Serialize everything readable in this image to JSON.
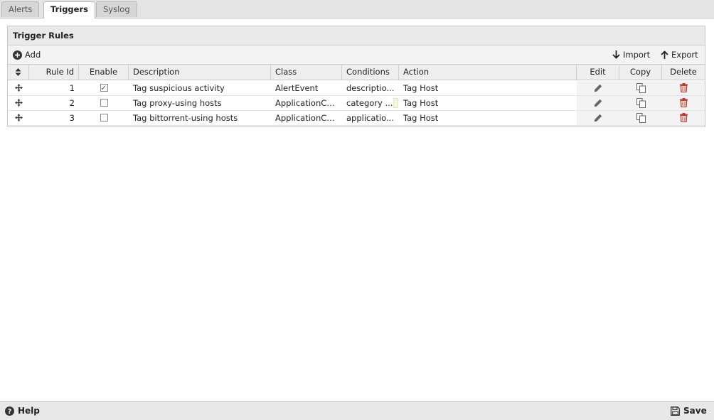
{
  "tabs": [
    {
      "label": "Alerts",
      "active": false
    },
    {
      "label": "Triggers",
      "active": true
    },
    {
      "label": "Syslog",
      "active": false
    }
  ],
  "panel": {
    "title": "Trigger Rules",
    "toolbar": {
      "add_label": "Add",
      "import_label": "Import",
      "export_label": "Export"
    },
    "columns": [
      "Rule Id",
      "Enable",
      "Description",
      "Class",
      "Conditions",
      "Action",
      "Edit",
      "Copy",
      "Delete"
    ],
    "rows": [
      {
        "rule_id": "1",
        "enabled": true,
        "description": "Tag suspicious activity",
        "class": "AlertEvent",
        "conditions": "descriptio...",
        "action": "Tag Host"
      },
      {
        "rule_id": "2",
        "enabled": false,
        "description": "Tag proxy-using hosts",
        "class": "ApplicationCo...",
        "conditions": "category ...",
        "action": "Tag Host"
      },
      {
        "rule_id": "3",
        "enabled": false,
        "description": "Tag bittorrent-using hosts",
        "class": "ApplicationCo...",
        "conditions": "applicatio...",
        "action": "Tag Host"
      }
    ]
  },
  "footer": {
    "help_label": "Help",
    "save_label": "Save"
  },
  "colors": {
    "delete_icon": "#c0392b",
    "icon_gray": "#666666"
  }
}
